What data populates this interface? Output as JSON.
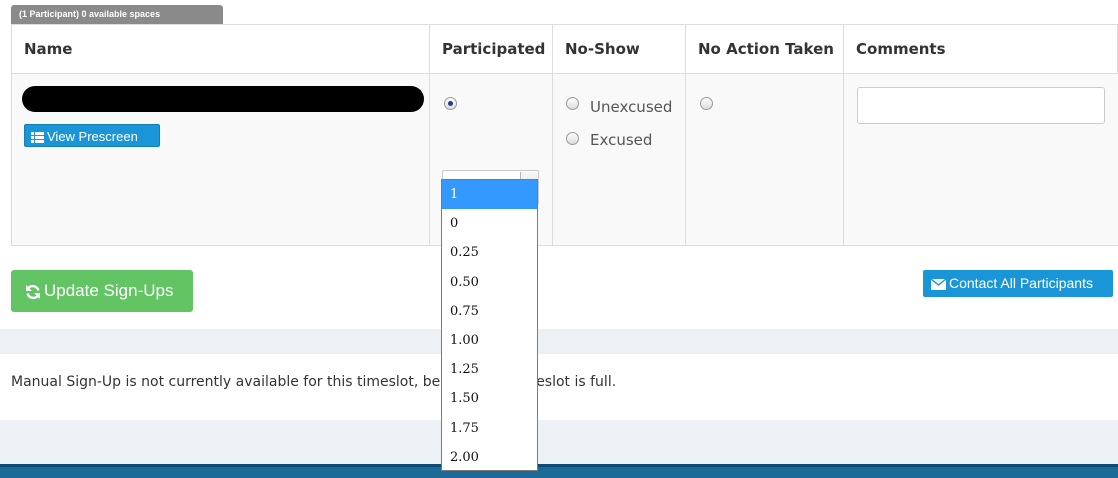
{
  "badge": "(1 Participant) 0 available spaces",
  "table": {
    "headers": [
      "Name",
      "Participated",
      "No-Show",
      "No Action Taken",
      "Comments"
    ],
    "row": {
      "view_prescreen_label": "View Prescreen",
      "participated_value": "1",
      "no_show_options": [
        "Unexcused",
        "Excused"
      ],
      "comment_value": ""
    }
  },
  "dropdown_options": [
    "1",
    "0",
    "0.25",
    "0.50",
    "0.75",
    "1.00",
    "1.25",
    "1.50",
    "1.75",
    "2.00"
  ],
  "buttons": {
    "update_label": "Update Sign-Ups",
    "contact_label": "Contact All Participants"
  },
  "notice": "Manual Sign-Up is not currently available for this timeslot, because the timeslot is full.",
  "colors": {
    "green": "#62c462",
    "blue": "#1a96d8",
    "selected": "#3399ff",
    "footer": "#1b6a98"
  }
}
